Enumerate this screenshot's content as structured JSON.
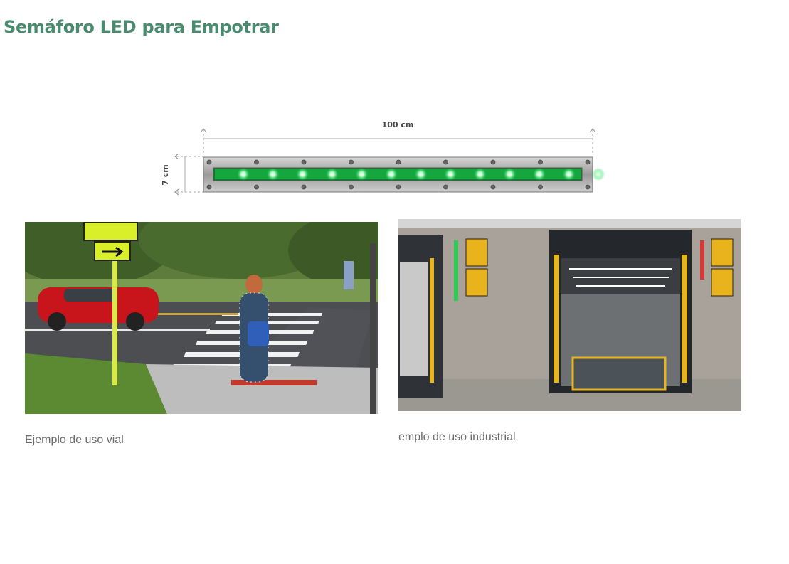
{
  "page": {
    "title": "Semáforo LED para Empotrar",
    "colors": {
      "title": "#4a8a6e",
      "caption": "#6b6b6b",
      "led_green": "#2ee06a"
    }
  },
  "diagram": {
    "width_label": "100 cm",
    "height_label": "7 cm",
    "led_color": "green"
  },
  "gallery": {
    "items": [
      {
        "caption": "Ejemplo de uso vial"
      },
      {
        "caption": "emplo de uso industrial"
      }
    ]
  }
}
